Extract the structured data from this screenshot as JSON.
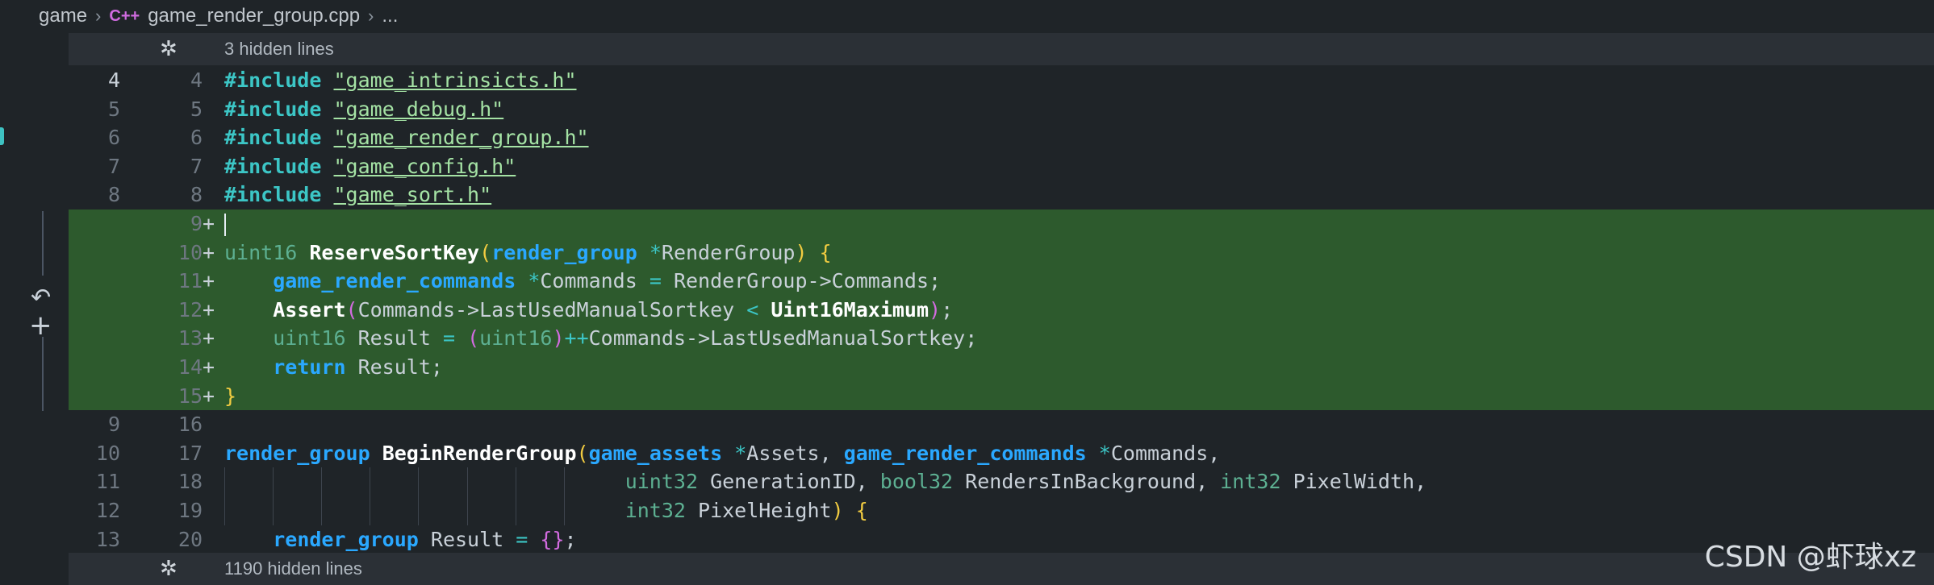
{
  "breadcrumb": {
    "folder": "game",
    "file_icon": "C++",
    "file": "game_render_group.cpp",
    "more": "..."
  },
  "hidden_top": {
    "label": "3 hidden lines"
  },
  "hidden_bottom": {
    "label": "1190 hidden lines"
  },
  "lines": [
    {
      "old": "4",
      "new": "4",
      "added": false,
      "tokens": [
        {
          "t": "#include",
          "c": "kw-inc"
        },
        {
          "t": " ",
          "c": "ident"
        },
        {
          "t": "\"game_intrinsicts.h\"",
          "c": "str"
        }
      ]
    },
    {
      "old": "5",
      "new": "5",
      "added": false,
      "tokens": [
        {
          "t": "#include",
          "c": "kw-inc"
        },
        {
          "t": " ",
          "c": "ident"
        },
        {
          "t": "\"game_debug.h\"",
          "c": "str"
        }
      ]
    },
    {
      "old": "6",
      "new": "6",
      "added": false,
      "tokens": [
        {
          "t": "#include",
          "c": "kw-inc"
        },
        {
          "t": " ",
          "c": "ident"
        },
        {
          "t": "\"game_render_group.h\"",
          "c": "str"
        }
      ]
    },
    {
      "old": "7",
      "new": "7",
      "added": false,
      "tokens": [
        {
          "t": "#include",
          "c": "kw-inc"
        },
        {
          "t": " ",
          "c": "ident"
        },
        {
          "t": "\"game_config.h\"",
          "c": "str"
        }
      ]
    },
    {
      "old": "8",
      "new": "8",
      "added": false,
      "tokens": [
        {
          "t": "#include",
          "c": "kw-inc"
        },
        {
          "t": " ",
          "c": "ident"
        },
        {
          "t": "\"game_sort.h\"",
          "c": "str"
        }
      ]
    },
    {
      "old": "",
      "new": "9",
      "added": true,
      "cursor": true,
      "tokens": []
    },
    {
      "old": "",
      "new": "10",
      "added": true,
      "tokens": [
        {
          "t": "uint16",
          "c": "type-green"
        },
        {
          "t": " ",
          "c": "ident"
        },
        {
          "t": "ReserveSortKey",
          "c": "fn"
        },
        {
          "t": "(",
          "c": "brace"
        },
        {
          "t": "render_group",
          "c": "type-blue"
        },
        {
          "t": " ",
          "c": "ident"
        },
        {
          "t": "*",
          "c": "op"
        },
        {
          "t": "RenderGroup",
          "c": "ident"
        },
        {
          "t": ")",
          "c": "brace"
        },
        {
          "t": " ",
          "c": "ident"
        },
        {
          "t": "{",
          "c": "brace"
        }
      ]
    },
    {
      "old": "",
      "new": "11",
      "added": true,
      "tokens": [
        {
          "t": "    ",
          "c": "ident"
        },
        {
          "t": "game_render_commands",
          "c": "type-blue"
        },
        {
          "t": " ",
          "c": "ident"
        },
        {
          "t": "*",
          "c": "op"
        },
        {
          "t": "Commands ",
          "c": "ident"
        },
        {
          "t": "=",
          "c": "op"
        },
        {
          "t": " RenderGroup->Commands;",
          "c": "ident"
        }
      ]
    },
    {
      "old": "",
      "new": "12",
      "added": true,
      "tokens": [
        {
          "t": "    ",
          "c": "ident"
        },
        {
          "t": "Assert",
          "c": "fn"
        },
        {
          "t": "(",
          "c": "paren-pink"
        },
        {
          "t": "Commands->LastUsedManualSortkey ",
          "c": "ident"
        },
        {
          "t": "<",
          "c": "op"
        },
        {
          "t": " ",
          "c": "ident"
        },
        {
          "t": "Uint16Maximum",
          "c": "fn"
        },
        {
          "t": ")",
          "c": "paren-pink"
        },
        {
          "t": ";",
          "c": "ident"
        }
      ]
    },
    {
      "old": "",
      "new": "13",
      "added": true,
      "tokens": [
        {
          "t": "    ",
          "c": "ident"
        },
        {
          "t": "uint16",
          "c": "type-green"
        },
        {
          "t": " Result ",
          "c": "ident"
        },
        {
          "t": "=",
          "c": "op"
        },
        {
          "t": " ",
          "c": "ident"
        },
        {
          "t": "(",
          "c": "paren-pink"
        },
        {
          "t": "uint16",
          "c": "type-green"
        },
        {
          "t": ")",
          "c": "paren-pink"
        },
        {
          "t": "++",
          "c": "op"
        },
        {
          "t": "Commands->LastUsedManualSortkey;",
          "c": "ident"
        }
      ]
    },
    {
      "old": "",
      "new": "14",
      "added": true,
      "tokens": [
        {
          "t": "    ",
          "c": "ident"
        },
        {
          "t": "return",
          "c": "type-blue"
        },
        {
          "t": " Result;",
          "c": "ident"
        }
      ]
    },
    {
      "old": "",
      "new": "15",
      "added": true,
      "tokens": [
        {
          "t": "}",
          "c": "brace"
        }
      ]
    },
    {
      "old": "9",
      "new": "16",
      "added": false,
      "tokens": []
    },
    {
      "old": "10",
      "new": "17",
      "added": false,
      "tokens": [
        {
          "t": "render_group",
          "c": "type-blue"
        },
        {
          "t": " ",
          "c": "ident"
        },
        {
          "t": "BeginRenderGroup",
          "c": "fn"
        },
        {
          "t": "(",
          "c": "brace"
        },
        {
          "t": "game_assets",
          "c": "type-blue"
        },
        {
          "t": " ",
          "c": "ident"
        },
        {
          "t": "*",
          "c": "op"
        },
        {
          "t": "Assets, ",
          "c": "ident"
        },
        {
          "t": "game_render_commands",
          "c": "type-blue"
        },
        {
          "t": " ",
          "c": "ident"
        },
        {
          "t": "*",
          "c": "op"
        },
        {
          "t": "Commands,",
          "c": "ident"
        }
      ]
    },
    {
      "old": "11",
      "new": "18",
      "added": false,
      "guides": true,
      "tokens": [
        {
          "t": "                                 ",
          "c": "ident"
        },
        {
          "t": "uint32",
          "c": "type-green"
        },
        {
          "t": " GenerationID, ",
          "c": "ident"
        },
        {
          "t": "bool32",
          "c": "type-green"
        },
        {
          "t": " RendersInBackground, ",
          "c": "ident"
        },
        {
          "t": "int32",
          "c": "type-green"
        },
        {
          "t": " PixelWidth,",
          "c": "ident"
        }
      ]
    },
    {
      "old": "12",
      "new": "19",
      "added": false,
      "guides": true,
      "tokens": [
        {
          "t": "                                 ",
          "c": "ident"
        },
        {
          "t": "int32",
          "c": "type-green"
        },
        {
          "t": " PixelHeight",
          "c": "ident"
        },
        {
          "t": ")",
          "c": "brace"
        },
        {
          "t": " ",
          "c": "ident"
        },
        {
          "t": "{",
          "c": "brace"
        }
      ]
    },
    {
      "old": "13",
      "new": "20",
      "added": false,
      "tokens": [
        {
          "t": "    ",
          "c": "ident"
        },
        {
          "t": "render_group",
          "c": "type-blue"
        },
        {
          "t": " Result ",
          "c": "ident"
        },
        {
          "t": "=",
          "c": "op"
        },
        {
          "t": " ",
          "c": "ident"
        },
        {
          "t": "{}",
          "c": "paren-pink"
        },
        {
          "t": ";",
          "c": "ident"
        }
      ]
    }
  ],
  "watermark": "CSDN @虾球xz"
}
